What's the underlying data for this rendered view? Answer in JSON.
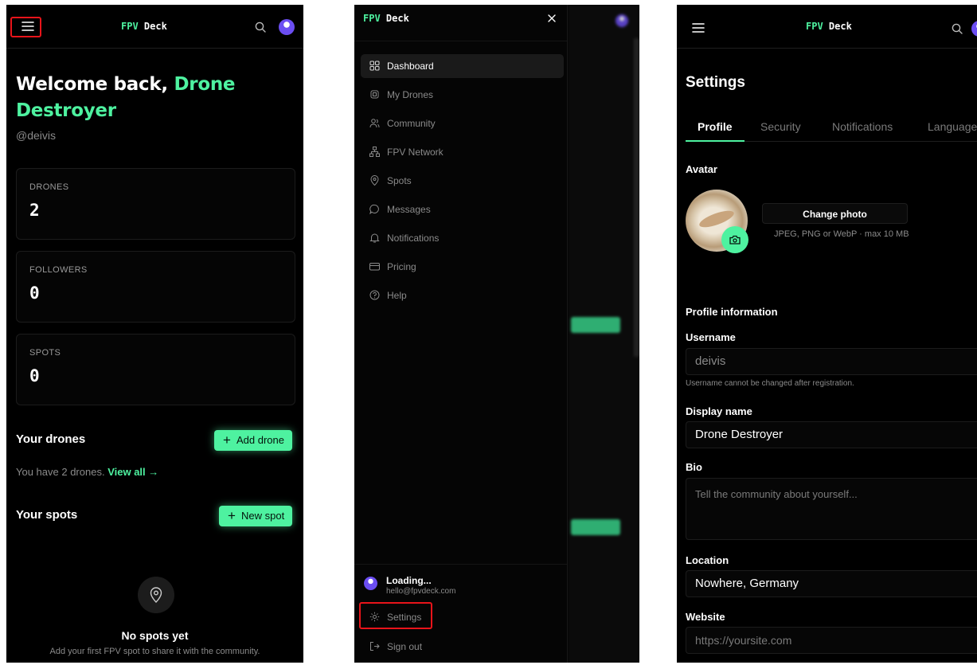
{
  "brand": {
    "part1": "FPV",
    "part2": "Deck"
  },
  "colors": {
    "accent": "#4ef2a0",
    "background": "#000000",
    "highlight": "#e8141a"
  },
  "dashboard": {
    "welcome_prefix": "Welcome back, ",
    "user_display_name": "Drone Destroyer",
    "handle": "@deivis",
    "stats": [
      {
        "label": "DRONES",
        "value": "2"
      },
      {
        "label": "FOLLOWERS",
        "value": "0"
      },
      {
        "label": "SPOTS",
        "value": "0"
      }
    ],
    "drones_section": {
      "title": "Your drones",
      "button": "Add drone",
      "summary": "You have 2 drones.",
      "link": "View all →"
    },
    "spots_section": {
      "title": "Your spots",
      "button": "New spot"
    },
    "empty_state": {
      "title": "No spots yet",
      "subtitle": "Add your first FPV spot to share it with the community."
    }
  },
  "drawer": {
    "items": [
      {
        "label": "Dashboard",
        "icon": "dashboard-icon",
        "active": true
      },
      {
        "label": "My Drones",
        "icon": "drone-icon",
        "active": false
      },
      {
        "label": "Community",
        "icon": "users-icon",
        "active": false
      },
      {
        "label": "FPV Network",
        "icon": "network-icon",
        "active": false
      },
      {
        "label": "Spots",
        "icon": "map-pin-icon",
        "active": false
      },
      {
        "label": "Messages",
        "icon": "message-icon",
        "active": false
      },
      {
        "label": "Notifications",
        "icon": "bell-icon",
        "active": false
      },
      {
        "label": "Pricing",
        "icon": "credit-card-icon",
        "active": false
      },
      {
        "label": "Help",
        "icon": "help-icon",
        "active": false
      }
    ],
    "user_name": "Loading...",
    "user_email": "hello@fpvdeck.com",
    "settings_label": "Settings",
    "signout_label": "Sign out"
  },
  "settings": {
    "title": "Settings",
    "tabs": [
      {
        "label": "Profile",
        "active": true
      },
      {
        "label": "Security",
        "active": false
      },
      {
        "label": "Notifications",
        "active": false
      },
      {
        "label": "Language",
        "active": false
      }
    ],
    "avatar_label": "Avatar",
    "change_photo": "Change photo",
    "photo_hint": "JPEG, PNG or WebP · max 10 MB",
    "profile_info_heading": "Profile information",
    "username_label": "Username",
    "username_value": "deivis",
    "username_help": "Username cannot be changed after registration.",
    "display_name_label": "Display name",
    "display_name_value": "Drone Destroyer",
    "bio_label": "Bio",
    "bio_placeholder": "Tell the community about yourself...",
    "location_label": "Location",
    "location_value": "Nowhere, Germany",
    "website_label": "Website",
    "website_placeholder": "https://yoursite.com"
  }
}
